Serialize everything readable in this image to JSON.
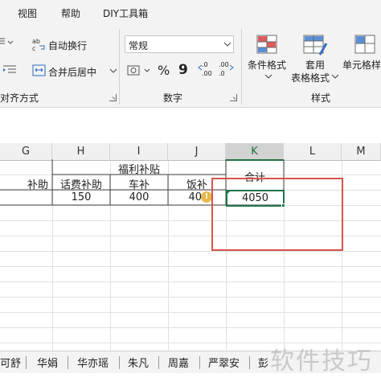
{
  "menu": {
    "view": "视图",
    "help": "帮助",
    "diy_tools": "DIY工具箱"
  },
  "ribbon": {
    "alignment": {
      "wrap_text": "自动换行",
      "merge_center": "合并后居中",
      "group_label": "对齐方式"
    },
    "number": {
      "format_value": "常规",
      "percent": "%",
      "comma": "9",
      "inc_decimal_top": ".0",
      "inc_decimal_bottom": ".00",
      "dec_decimal_top": ".00",
      "dec_decimal_bottom": ".0",
      "group_label": "数字"
    },
    "styles": {
      "conditional": "条件格式",
      "table_fmt_line1": "套用",
      "table_fmt_line2": "表格格式",
      "cell_styles": "单元格样",
      "group_label": "样式"
    }
  },
  "columns": [
    "G",
    "H",
    "I",
    "J",
    "K",
    "L",
    "M"
  ],
  "selected_column": "K",
  "rows": {
    "header_merged": "福利补贴",
    "header_total": "合计",
    "subheaders": {
      "G": "补助",
      "H": "话费补助",
      "I": "车补",
      "J": "饭补"
    },
    "values": {
      "H": "150",
      "I": "400",
      "J": "40",
      "K": "4050"
    }
  },
  "warning_glyph": "!",
  "sheet_tabs": [
    "可舒",
    "华娟",
    "华亦瑶",
    "朱凡",
    "周嘉",
    "严翠安",
    "彭"
  ],
  "watermark": "软件技巧",
  "colors": {
    "accent_green": "#217346",
    "highlight_red": "#d9534f"
  }
}
